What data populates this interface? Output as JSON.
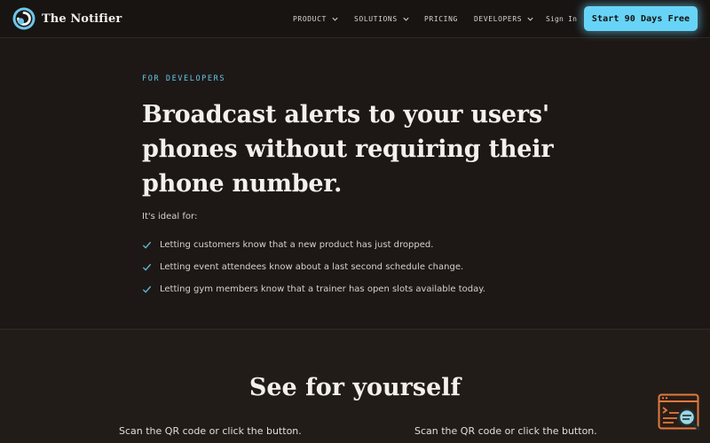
{
  "header": {
    "brand": "The Notifier",
    "logo_icon": "notifier-logo-icon",
    "nav": [
      {
        "label": "PRODUCT",
        "has_dropdown": true
      },
      {
        "label": "SOLUTIONS",
        "has_dropdown": true
      },
      {
        "label": "PRICING",
        "has_dropdown": false
      },
      {
        "label": "DEVELOPERS",
        "has_dropdown": true
      }
    ],
    "sign_in": "Sign In",
    "cta": "Start 90 Days Free"
  },
  "hero": {
    "eyebrow": "FOR DEVELOPERS",
    "headline_lines": [
      "Broadcast alerts to your users'",
      "phones without requiring their",
      "phone number."
    ],
    "ideal_for": "It's ideal for:",
    "benefits": [
      "Letting customers know that a new product has just dropped.",
      "Letting event attendees know about a last second schedule change.",
      "Letting gym members know that a trainer has open slots available today."
    ]
  },
  "section2": {
    "title": "See for yourself",
    "left_caption": "Scan the QR code or click the button.",
    "right_caption": "Scan the QR code or click the button."
  },
  "widget": {
    "icon": "search-log-icon"
  },
  "colors": {
    "background": "#1d1816",
    "header_bg": "#181412",
    "section_bg": "#221c19",
    "accent": "#67d4f7",
    "eyebrow": "#67c6e8",
    "check": "#5fc4e0",
    "widget": "#e07a3f"
  }
}
